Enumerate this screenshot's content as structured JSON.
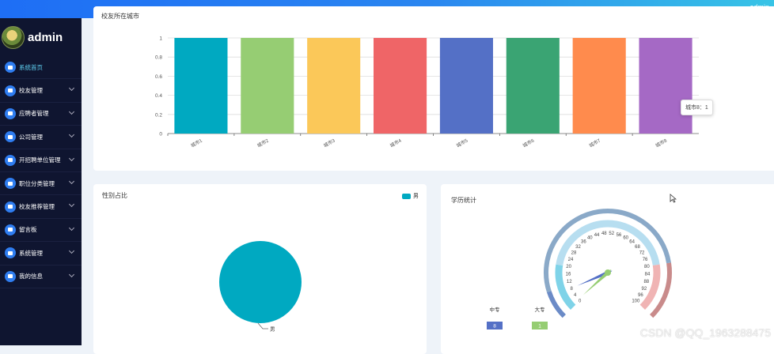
{
  "header": {
    "user": "admin"
  },
  "sidebar": {
    "brand": "admin",
    "items": [
      {
        "label": "系统首页",
        "icon": "home-icon",
        "active": true
      },
      {
        "label": "校友管理",
        "icon": "thumb-icon"
      },
      {
        "label": "应聘者管理",
        "icon": "briefcase-icon"
      },
      {
        "label": "公司管理",
        "icon": "grid-icon"
      },
      {
        "label": "开招聘单位管理",
        "icon": "list-icon"
      },
      {
        "label": "职位分类管理",
        "icon": "card-icon"
      },
      {
        "label": "校友推荐管理",
        "icon": "people-icon"
      },
      {
        "label": "留言板",
        "icon": "grid-icon"
      },
      {
        "label": "系统管理",
        "icon": "doc-icon"
      },
      {
        "label": "我的信息",
        "icon": "profile-icon"
      }
    ]
  },
  "cards": {
    "city": {
      "title": "校友所在城市",
      "tooltip": "城市8：1"
    },
    "gender": {
      "title": "性别占比",
      "legend": "男",
      "slice_label": "男"
    },
    "edu": {
      "title": "学历统计"
    }
  },
  "chart_data": [
    {
      "type": "bar",
      "categories": [
        "城市1",
        "城市2",
        "城市3",
        "城市4",
        "城市5",
        "城市6",
        "城市7",
        "城市8"
      ],
      "values": [
        1,
        1,
        1,
        1,
        1,
        1,
        1,
        1
      ],
      "colors": [
        "#00a9c1",
        "#96cd73",
        "#fbc859",
        "#ef6567",
        "#5470c6",
        "#3aa473",
        "#ff8b4d",
        "#a569c5"
      ],
      "ylim": [
        0,
        1
      ],
      "yticks": [
        "0",
        "0.2",
        "0.4",
        "0.6",
        "0.8",
        "1"
      ],
      "grid": true
    },
    {
      "type": "pie",
      "categories": [
        "男"
      ],
      "values": [
        1
      ],
      "colors": [
        "#00a9c1"
      ],
      "legend_position": "top-right"
    },
    {
      "type": "gauge",
      "min": 0,
      "max": 100,
      "ticks": [
        "0",
        "4",
        "8",
        "12",
        "16",
        "20",
        "24",
        "28",
        "32",
        "36",
        "40",
        "44",
        "48",
        "52",
        "56",
        "60",
        "64",
        "68",
        "72",
        "76",
        "80",
        "84",
        "88",
        "92",
        "96",
        "100"
      ],
      "pointers": [
        {
          "name": "中专",
          "value": 8,
          "color": "#5470c6"
        },
        {
          "name": "大专",
          "value": 1,
          "color": "#96cd73"
        }
      ]
    }
  ],
  "watermark": "CSDN @QQ_1963288475"
}
